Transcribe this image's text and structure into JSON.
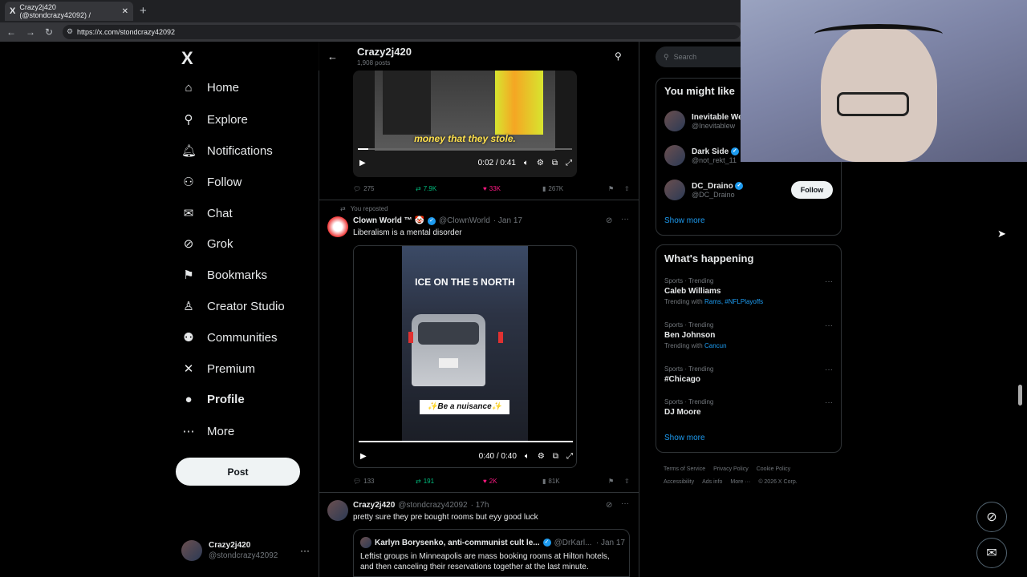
{
  "browser": {
    "tab_title": "Crazy2j420 (@stondcrazy42092) /",
    "tab_favicon": "X",
    "new_tab_icon": "+",
    "url": "https://x.com/stondcrazy42092"
  },
  "nav": {
    "logo": "X",
    "items": [
      {
        "label": "Home",
        "icon": "home-icon",
        "glyph": "⌂"
      },
      {
        "label": "Explore",
        "icon": "search-icon",
        "glyph": "⚲"
      },
      {
        "label": "Notifications",
        "icon": "bell-icon",
        "glyph": "🔔︎"
      },
      {
        "label": "Follow",
        "icon": "person-plus-icon",
        "glyph": "⚇"
      },
      {
        "label": "Chat",
        "icon": "envelope-icon",
        "glyph": "✉"
      },
      {
        "label": "Grok",
        "icon": "grok-icon",
        "glyph": "⊘"
      },
      {
        "label": "Bookmarks",
        "icon": "bookmark-icon",
        "glyph": "⚑"
      },
      {
        "label": "Creator Studio",
        "icon": "flask-icon",
        "glyph": "♙"
      },
      {
        "label": "Communities",
        "icon": "people-icon",
        "glyph": "⚉"
      },
      {
        "label": "Premium",
        "icon": "x-icon",
        "glyph": "✕"
      },
      {
        "label": "Profile",
        "icon": "person-icon",
        "glyph": "●"
      },
      {
        "label": "More",
        "icon": "more-circle-icon",
        "glyph": "⋯"
      }
    ],
    "post_label": "Post",
    "account": {
      "name": "Crazy2j420",
      "handle": "@stondcrazy42092",
      "more": "···"
    }
  },
  "header": {
    "name": "Crazy2j420",
    "posts": "1,908 posts"
  },
  "tweet1": {
    "caption": "money that they stole.",
    "time": "0:02 / 0:41",
    "progress": 0.05,
    "replies": "275",
    "reposts": "7.9K",
    "likes": "33K",
    "views": "267K"
  },
  "tweet2": {
    "repost_note": "You reposted",
    "name": "Clown World ™ 🤡",
    "handle": "@ClownWorld",
    "date": "· Jan 17",
    "text": "Liberalism is a mental disorder",
    "video_title": "ICE ON THE 5 NORTH",
    "video_caption": "✨Be a nuisance✨",
    "time": "0:40 / 0:40",
    "progress": 1.0,
    "replies": "133",
    "reposts": "191",
    "likes": "2K",
    "views": "81K"
  },
  "tweet3": {
    "name": "Crazy2j420",
    "handle": "@stondcrazy42092",
    "date": "· 17h",
    "text": "pretty sure they pre bought rooms but eyy good luck",
    "quote": {
      "name": "Karlyn Borysenko, anti-communist cult le...",
      "handle": "@DrKarl...",
      "date": "· Jan 17",
      "text": "Leftist groups in Minneapolis are mass booking rooms at Hilton hotels, and then canceling their reservations together at the last minute."
    }
  },
  "right": {
    "search_placeholder": "Search",
    "might_like_title": "You might like",
    "suggestions": [
      {
        "name": "Inevitable We",
        "handle": "@Inevitablew"
      },
      {
        "name": "Dark Side",
        "handle": "@not_rekt_11"
      },
      {
        "name": "DC_Draino",
        "handle": "@DC_Draino",
        "follow": "Follow"
      }
    ],
    "show_more": "Show more",
    "happening_title": "What's happening",
    "trends": [
      {
        "cat": "Sports · Trending",
        "name": "Caleb Williams",
        "with_label": "Trending with",
        "with": "Rams, #NFLPlayoffs"
      },
      {
        "cat": "Sports · Trending",
        "name": "Ben Johnson",
        "with_label": "Trending with",
        "with": "Cancun"
      },
      {
        "cat": "Sports · Trending",
        "name": "#Chicago",
        "with_label": "",
        "with": ""
      },
      {
        "cat": "Sports · Trending",
        "name": "DJ Moore",
        "with_label": "",
        "with": ""
      }
    ],
    "show_more2": "Show more",
    "footer": [
      "Terms of Service",
      "Privacy Policy",
      "Cookie Policy",
      "Accessibility",
      "Ads info",
      "More ···",
      "© 2026 X Corp."
    ]
  },
  "colors": {
    "accent": "#1d9bf0",
    "repost_green": "#00ba7c",
    "like_pink": "#f91880",
    "bg": "#000000"
  }
}
